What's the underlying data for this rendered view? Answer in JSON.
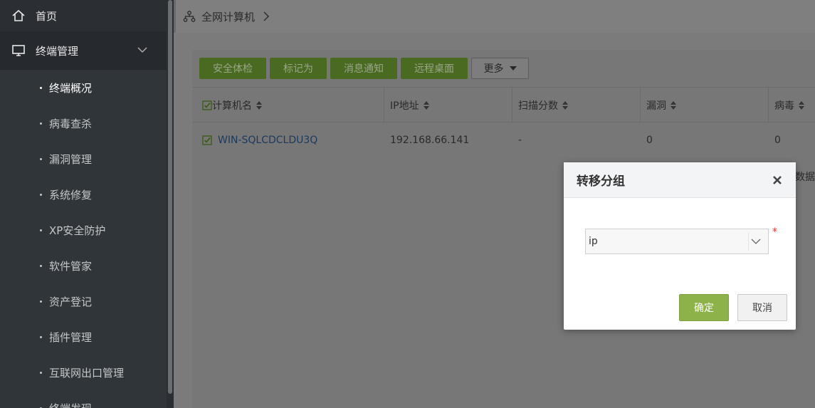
{
  "sidebar": {
    "home_label": "首页",
    "group_label": "终端管理",
    "items": [
      {
        "label": "终端概况",
        "active": true
      },
      {
        "label": "病毒查杀"
      },
      {
        "label": "漏洞管理"
      },
      {
        "label": "系统修复"
      },
      {
        "label": "XP安全防护"
      },
      {
        "label": "软件管家"
      },
      {
        "label": "资产登记"
      },
      {
        "label": "插件管理"
      },
      {
        "label": "互联网出口管理"
      },
      {
        "label": "终端发现"
      }
    ]
  },
  "breadcrumb": {
    "label": "全网计算机"
  },
  "toolbar": {
    "buttons": [
      "安全体检",
      "标记为",
      "消息通知",
      "远程桌面"
    ],
    "more_label": "更多"
  },
  "table": {
    "columns": [
      "计算机名",
      "IP地址",
      "扫描分数",
      "漏洞",
      "病毒"
    ],
    "rows": [
      {
        "name": "WIN-SQLCDCLDU3Q",
        "ip": "192.168.66.141",
        "score": "-",
        "vuln": "0",
        "virus": "0"
      }
    ],
    "trailing_text": "数据"
  },
  "modal": {
    "title": "转移分组",
    "select_value": "ip",
    "required_mark": "*",
    "ok_label": "确定",
    "cancel_label": "取消"
  },
  "colors": {
    "accent": "#8db24a",
    "sidebar_bg": "#2b2f33"
  }
}
